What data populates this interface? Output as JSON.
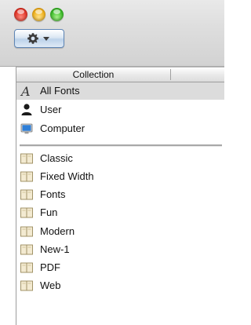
{
  "window": {
    "controls": {
      "close_color": "#e2382c",
      "minimize_color": "#f0b21e",
      "zoom_color": "#3fbe2c"
    }
  },
  "toolbar": {
    "action_icon": "gear-icon"
  },
  "list": {
    "column_header": "Collection",
    "system_items": [
      {
        "label": "All Fonts",
        "icon": "all-fonts-icon",
        "selected": true
      },
      {
        "label": "User",
        "icon": "user-icon",
        "selected": false
      },
      {
        "label": "Computer",
        "icon": "computer-icon",
        "selected": false
      }
    ],
    "collections": [
      {
        "label": "Classic",
        "icon": "book-icon"
      },
      {
        "label": "Fixed Width",
        "icon": "book-icon"
      },
      {
        "label": "Fonts",
        "icon": "book-icon"
      },
      {
        "label": "Fun",
        "icon": "book-icon"
      },
      {
        "label": "Modern",
        "icon": "book-icon"
      },
      {
        "label": "New-1",
        "icon": "book-icon"
      },
      {
        "label": "PDF",
        "icon": "book-icon"
      },
      {
        "label": "Web",
        "icon": "book-icon"
      }
    ]
  }
}
